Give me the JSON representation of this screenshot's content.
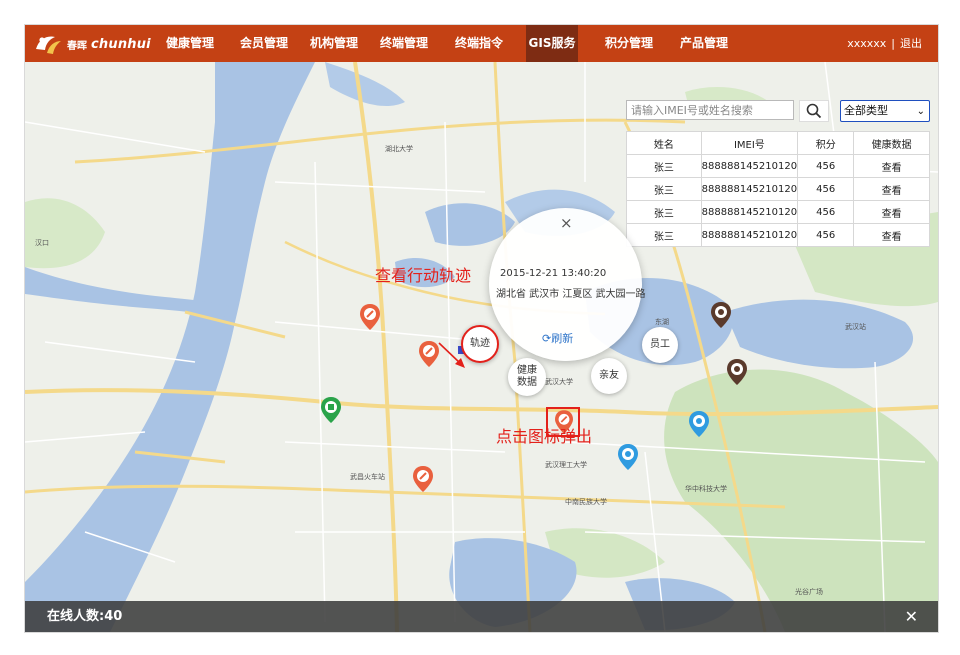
{
  "brand": {
    "cn": "春晖",
    "en": "chunhui"
  },
  "nav": {
    "items": [
      {
        "label": "健康管理"
      },
      {
        "label": "会员管理"
      },
      {
        "label": "机构管理"
      },
      {
        "label": "终端管理"
      },
      {
        "label": "终端指令"
      },
      {
        "label": "GIS服务"
      },
      {
        "label": "积分管理"
      },
      {
        "label": "产品管理"
      }
    ],
    "active": "GIS服务",
    "user": "xxxxxx",
    "separator": "|",
    "logout": "退出"
  },
  "search": {
    "placeholder": "请输入IMEI号或姓名搜索",
    "type_selected": "全部类型"
  },
  "table": {
    "headers": [
      "姓名",
      "IMEI号",
      "积分",
      "健康数据"
    ],
    "rows": [
      [
        "张三",
        "888888145210120",
        "456",
        "查看"
      ],
      [
        "张三",
        "888888145210120",
        "456",
        "查看"
      ],
      [
        "张三",
        "888888145210120",
        "456",
        "查看"
      ],
      [
        "张三",
        "888888145210120",
        "456",
        "查看"
      ]
    ]
  },
  "popup": {
    "close": "×",
    "time": "2015-12-21 13:40:20",
    "address": "湖北省 武汉市 江夏区 武大园一路",
    "refresh": "刷新"
  },
  "bubbles": {
    "track": "轨迹",
    "health_line1": "健康",
    "health_line2": "数据",
    "family": "亲友",
    "staff": "员工"
  },
  "annotations": {
    "view_track": "查看行动轨迹",
    "click_icon": "点击图标弹出"
  },
  "footer": {
    "online": "在线人数:40",
    "close": "✕"
  },
  "map_labels": [
    "汉口",
    "湖北大学",
    "武汉大学",
    "华中科技大学",
    "光谷广场",
    "武昌火车站",
    "武汉站",
    "东湖",
    "中南民族大学",
    "武汉理工大学"
  ],
  "colors": {
    "nav_bg": "#c44114",
    "nav_active": "#7e2c13",
    "river": "#a9c3e4",
    "land": "#eef0ea",
    "marker_orange": "#e9603e",
    "marker_blue": "#2f9be0",
    "marker_green": "#2aa34a",
    "marker_brown": "#5a3a2c",
    "annotation_red": "#e3211b",
    "link_blue": "#2e74c9"
  }
}
